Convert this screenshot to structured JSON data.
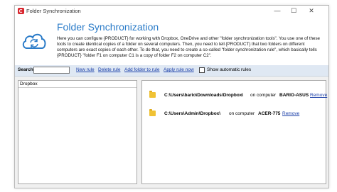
{
  "window": {
    "title": "Folder Synchronization",
    "controls": {
      "minimize": "—",
      "maximize": "☐",
      "close": "✕"
    }
  },
  "header": {
    "title": "Folder Synchronization",
    "description": "Here you can configure {PRODUCT} for working with Dropbox, OneDrive and other \"folder synchronization tools\". You use one of these tools to create identical copies of a folder on several computers. Then, you need to tell {PRODUCT} that two folders on different computers are exact copies of each other. To do that, you need to create a so-called \"folder synchronization rule\", which basically tells {PRODUCT} \"folder F1 on computer C1 is a copy of folder F2 on computer C2\"."
  },
  "toolbar": {
    "search_label": "Search",
    "search_value": "",
    "new_rule": "New rule",
    "delete_rule": "Delete rule",
    "add_folder": "Add folder to rule",
    "apply_now": "Apply rule now",
    "show_auto_label": "Show automatic rules",
    "show_auto_checked": false
  },
  "rules_list": {
    "header": "Dropbox"
  },
  "rule_folders": [
    {
      "path": "C:\\Users\\bario\\Downloads\\Dropbox\\",
      "on_text": "on computer",
      "computer": "BARIO-ASUS",
      "remove": "Remove"
    },
    {
      "path": "C:\\Users\\Admin\\Dropbox\\",
      "on_text": "on computer",
      "computer": "ACER-775",
      "remove": "Remove"
    }
  ],
  "colors": {
    "accent": "#2a7bc8",
    "link": "#1a3ea8",
    "toolbar_bg": "#dfe8f3",
    "folder": "#f0c234",
    "app_icon": "#d8262e"
  }
}
